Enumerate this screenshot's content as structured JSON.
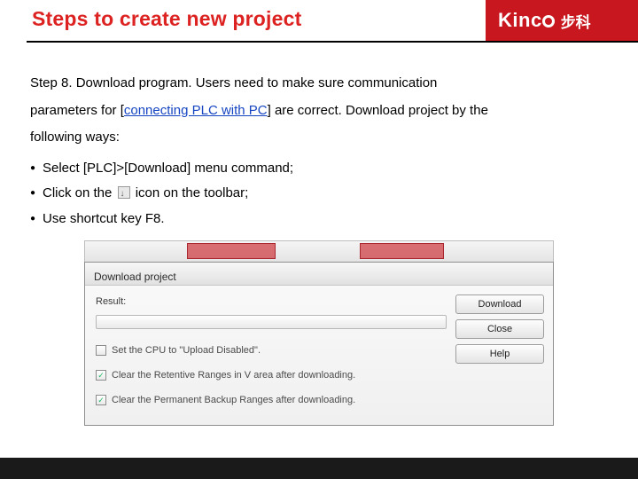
{
  "header": {
    "title": "Steps to create new project",
    "brand_main_left": "Kinc",
    "brand_cn": "步科"
  },
  "body": {
    "p1_a": "Step 8. Download program. Users need to make sure communication",
    "p2_a": "parameters for [",
    "p2_link": "connecting PLC with PC",
    "p2_b": "] are correct. Download project by the",
    "p3": "following ways:",
    "bullets": {
      "b1": "Select [PLC]>[Download] menu command;",
      "b2_a": "Click on the",
      "b2_b": "icon on the toolbar;",
      "b3": "Use shortcut key F8."
    }
  },
  "dialog": {
    "title": "Download project",
    "result_label": "Result:",
    "btn_download": "Download",
    "btn_close": "Close",
    "btn_help": "Help",
    "chk1": "Set the CPU to \"Upload Disabled\".",
    "chk2": "Clear the Retentive Ranges in V area after downloading.",
    "chk3": "Clear the Permanent Backup Ranges after downloading."
  }
}
